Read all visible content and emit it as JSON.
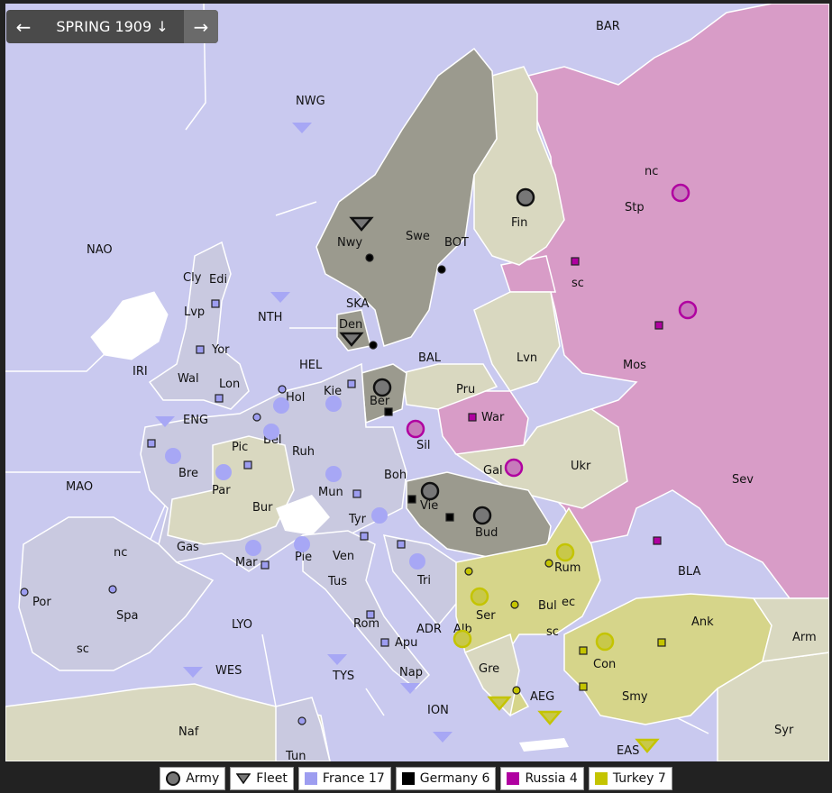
{
  "nav": {
    "prev_icon": "←",
    "season": "SPRING 1909 ↓",
    "next_icon": "→"
  },
  "colors": {
    "sea": "#c9c9ef",
    "neutral": "#d9d8c0",
    "france": "#9d9df0",
    "germany": "#000000",
    "russia": "#b000a0",
    "turkey": "#c4c400",
    "germany_land": "#9b9a8e",
    "russia_land": "#d89cc7",
    "turkey_land": "#d6d58a",
    "france_land": "#c9c9e0"
  },
  "seas": [
    "BAR",
    "NWG",
    "NAO",
    "NTH",
    "SKA",
    "HEL",
    "BAL",
    "BOT",
    "IRI",
    "ENG",
    "MAO",
    "LYO",
    "WES",
    "TYS",
    "ION",
    "ADR",
    "AEG",
    "EAS",
    "BLA"
  ],
  "labels": {
    "bar": "BAR",
    "nwg": "NWG",
    "nao": "NAO",
    "nth": "NTH",
    "ska": "SKA",
    "hel": "HEL",
    "bal": "BAL",
    "bot": "BOT",
    "iri": "IRI",
    "eng": "ENG",
    "mao": "MAO",
    "lyo": "LYO",
    "wes": "WES",
    "tys": "TYS",
    "ion": "ION",
    "adr": "ADR",
    "aeg": "AEG",
    "eas": "EAS",
    "bla": "BLA",
    "nwy": "Nwy",
    "swe": "Swe",
    "fin": "Fin",
    "stp": "Stp",
    "stp_nc": "nc",
    "stp_sc": "sc",
    "mos": "Mos",
    "lvn": "Lvn",
    "war": "War",
    "pru": "Pru",
    "sil": "Sil",
    "ber": "Ber",
    "kie": "Kie",
    "den": "Den",
    "hol": "Hol",
    "bel": "Bel",
    "ruh": "Ruh",
    "mun": "Mun",
    "boh": "Boh",
    "gal": "Gal",
    "ukr": "Ukr",
    "sev": "Sev",
    "vie": "Vie",
    "bud": "Bud",
    "tyr": "Tyr",
    "tri": "Tri",
    "rum": "Rum",
    "ser": "Ser",
    "bul": "Bul",
    "bul_ec": "ec",
    "bul_sc": "sc",
    "alb": "Alb",
    "gre": "Gre",
    "con": "Con",
    "ank": "Ank",
    "arm": "Arm",
    "smy": "Smy",
    "syr": "Syr",
    "cly": "Cly",
    "edi": "Edi",
    "lvp": "Lvp",
    "yor": "Yor",
    "wal": "Wal",
    "lon": "Lon",
    "pic": "Pic",
    "bre": "Bre",
    "par": "Par",
    "bur": "Bur",
    "gas": "Gas",
    "mar": "Mar",
    "pie": "Pie",
    "ven": "Ven",
    "tus": "Tus",
    "rom": "Rom",
    "apu": "Apu",
    "nap": "Nap",
    "spa": "Spa",
    "spa_nc": "nc",
    "spa_sc": "sc",
    "por": "Por",
    "naf": "Naf",
    "tun": "Tun"
  },
  "legend": {
    "army": "Army",
    "fleet": "Fleet",
    "france": "France 17",
    "germany": "Germany 6",
    "russia": "Russia 4",
    "turkey": "Turkey 7"
  }
}
